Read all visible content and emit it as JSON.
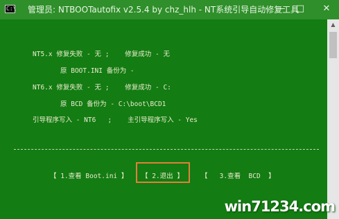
{
  "window": {
    "title": "管理员: NTBOOTautofix v2.5.4 by chz_hlh - NT系统引导自动修复工具",
    "console_icon_label": "C:\\",
    "minimize_label": "—",
    "maximize_label": "□",
    "close_label": "✕"
  },
  "console": {
    "lines": [
      "NT5.x 修复失败 - 无 ;    修复成功 - 无",
      "原 BOOT.INI 备份为 -",
      "NT6.x 修复失败 - 无 ;    修复成功 - C:",
      "原 BCD 备份为 - C:\\boot\\BCD1",
      "引导程序写入 - NT6   ;    主引导程序写入 - Yes"
    ]
  },
  "buttons": {
    "view_boot_ini": "【 1.查看 Boot.ini 】",
    "exit": "【 2.退出 】",
    "view_bcd": "【   3.查看  BCD  】"
  },
  "watermark": "win71234.com"
}
